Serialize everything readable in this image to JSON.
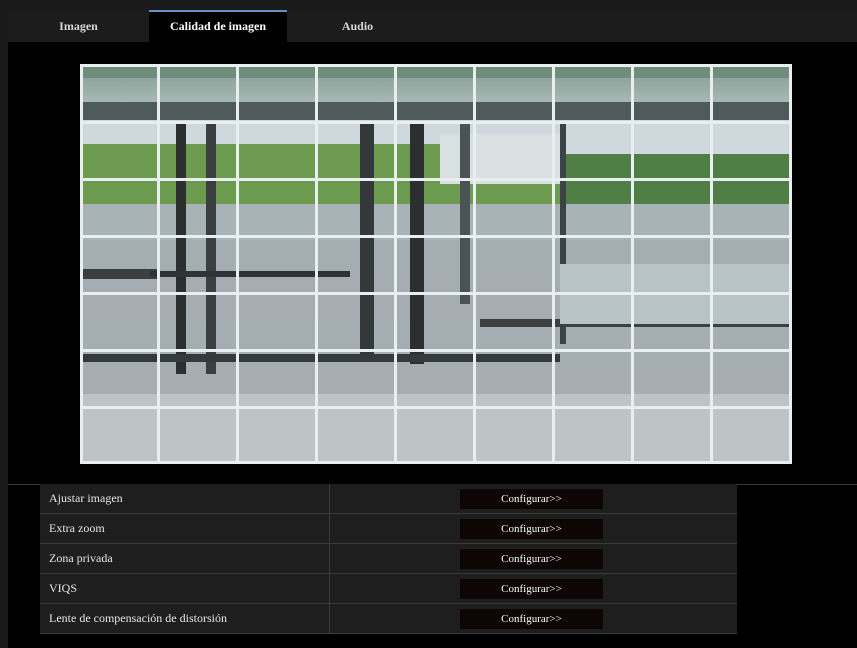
{
  "tabs": [
    {
      "label": "Imagen"
    },
    {
      "label": "Calidad de imagen"
    },
    {
      "label": "Audio"
    }
  ],
  "preview": {
    "grid_columns": 9,
    "grid_rows": 7,
    "grid_color": "#e9eef0"
  },
  "settings": [
    {
      "label": "Ajustar imagen",
      "button": "Configurar>>"
    },
    {
      "label": "Extra zoom",
      "button": "Configurar>>"
    },
    {
      "label": "Zona privada",
      "button": "Configurar>>"
    },
    {
      "label": "VIQS",
      "button": "Configurar>>"
    },
    {
      "label": "Lente de compensación de distorsión",
      "button": "Configurar>>"
    }
  ],
  "colors": {
    "background": "#000000",
    "tab_active_accent": "#6a8fc4",
    "button_bg": "#0d0604"
  }
}
